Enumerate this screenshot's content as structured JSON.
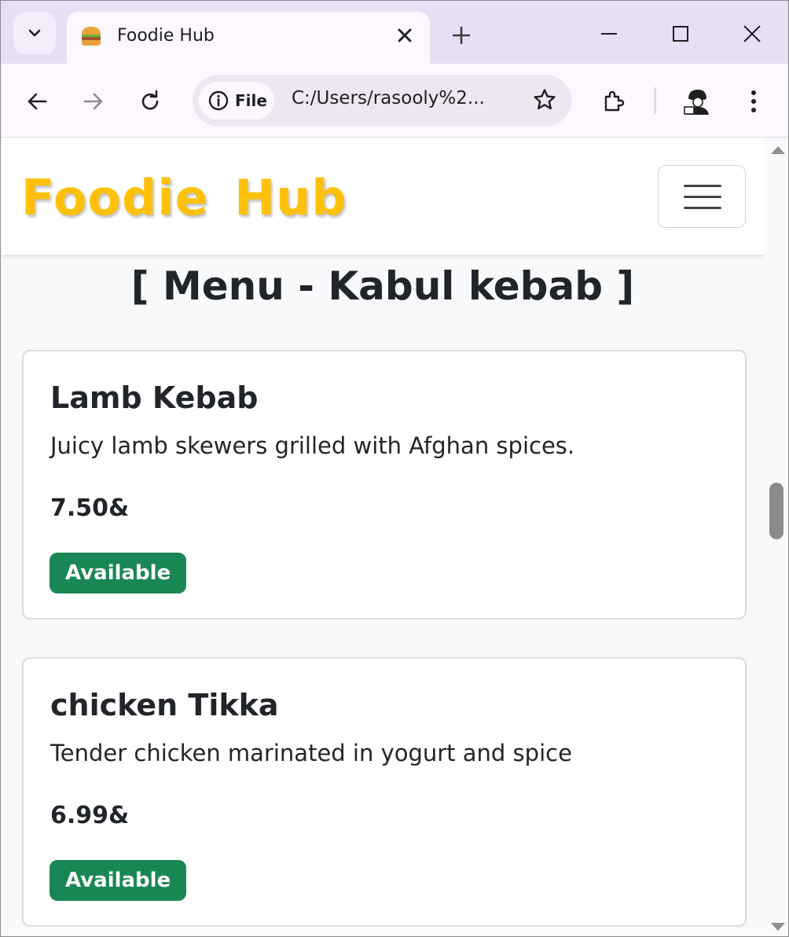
{
  "browser": {
    "tab_title": "Foodie Hub",
    "omnibox_chip": "File",
    "url": "C:/Users/rasooly%2..."
  },
  "navbar": {
    "brand": "Foodie Hub"
  },
  "page": {
    "heading": "[ Menu - Kabul kebab ]",
    "items": [
      {
        "name": "Lamb Kebab",
        "description": "Juicy lamb skewers grilled with Afghan spices.",
        "price": "7.50&",
        "status": "Available"
      },
      {
        "name": "chicken Tikka",
        "description": "Tender chicken marinated in yogurt and spice",
        "price": "6.99&",
        "status": "Available"
      }
    ]
  },
  "colors": {
    "brand": "#ffc107",
    "badge": "#198754",
    "tabstrip": "#e8dff5",
    "toolbar": "#fdf7ff"
  },
  "icons": [
    "tab-search-icon",
    "burger-favicon-icon",
    "close-icon",
    "plus-icon",
    "minimize-icon",
    "maximize-icon",
    "window-close-icon",
    "back-arrow-icon",
    "forward-arrow-icon",
    "reload-icon",
    "info-icon",
    "star-icon",
    "extensions-icon",
    "profile-avatar-icon",
    "kebab-menu-icon",
    "hamburger-icon"
  ]
}
